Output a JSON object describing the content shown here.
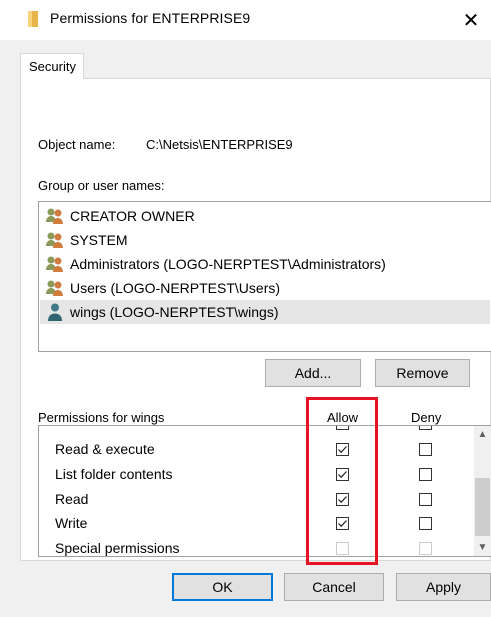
{
  "window": {
    "title": "Permissions for ENTERPRISE9",
    "close_glyph": "✕"
  },
  "tabs": [
    {
      "label": "Security",
      "active": true
    }
  ],
  "object": {
    "label": "Object name:",
    "value": "C:\\Netsis\\ENTERPRISE9"
  },
  "groups": {
    "label": "Group or user names:",
    "items": [
      {
        "name": "CREATOR OWNER",
        "icon": "users-group-icon",
        "selected": false
      },
      {
        "name": "SYSTEM",
        "icon": "users-group-icon",
        "selected": false
      },
      {
        "name": "Administrators (LOGO-NERPTEST\\Administrators)",
        "icon": "users-group-icon",
        "selected": false
      },
      {
        "name": "Users (LOGO-NERPTEST\\Users)",
        "icon": "users-group-icon",
        "selected": false
      },
      {
        "name": "wings (LOGO-NERPTEST\\wings)",
        "icon": "user-icon",
        "selected": true
      }
    ]
  },
  "buttons": {
    "add": "Add...",
    "remove": "Remove",
    "ok": "OK",
    "cancel": "Cancel",
    "apply": "Apply"
  },
  "permissions": {
    "label": "Permissions for wings",
    "allow_header": "Allow",
    "deny_header": "Deny",
    "rows": [
      {
        "name": "Read & execute",
        "allow": true,
        "deny": false,
        "disabled": false
      },
      {
        "name": "List folder contents",
        "allow": true,
        "deny": false,
        "disabled": false
      },
      {
        "name": "Read",
        "allow": true,
        "deny": false,
        "disabled": false
      },
      {
        "name": "Write",
        "allow": true,
        "deny": false,
        "disabled": false
      },
      {
        "name": "Special permissions",
        "allow": false,
        "deny": false,
        "disabled": true
      }
    ]
  },
  "colors": {
    "highlight": "#e81123",
    "selection": "#e6e6e6",
    "dialog_bg": "#f0f0f0",
    "ok_border": "#0078d7"
  }
}
